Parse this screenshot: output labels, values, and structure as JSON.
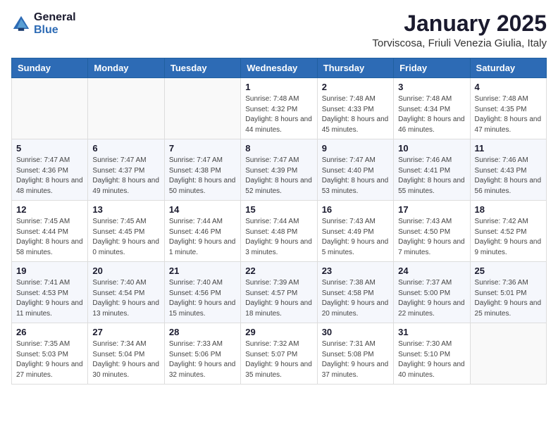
{
  "header": {
    "logo_general": "General",
    "logo_blue": "Blue",
    "month_title": "January 2025",
    "subtitle": "Torviscosa, Friuli Venezia Giulia, Italy"
  },
  "weekdays": [
    "Sunday",
    "Monday",
    "Tuesday",
    "Wednesday",
    "Thursday",
    "Friday",
    "Saturday"
  ],
  "weeks": [
    [
      {
        "day": "",
        "sunrise": "",
        "sunset": "",
        "daylight": ""
      },
      {
        "day": "",
        "sunrise": "",
        "sunset": "",
        "daylight": ""
      },
      {
        "day": "",
        "sunrise": "",
        "sunset": "",
        "daylight": ""
      },
      {
        "day": "1",
        "sunrise": "Sunrise: 7:48 AM",
        "sunset": "Sunset: 4:32 PM",
        "daylight": "Daylight: 8 hours and 44 minutes."
      },
      {
        "day": "2",
        "sunrise": "Sunrise: 7:48 AM",
        "sunset": "Sunset: 4:33 PM",
        "daylight": "Daylight: 8 hours and 45 minutes."
      },
      {
        "day": "3",
        "sunrise": "Sunrise: 7:48 AM",
        "sunset": "Sunset: 4:34 PM",
        "daylight": "Daylight: 8 hours and 46 minutes."
      },
      {
        "day": "4",
        "sunrise": "Sunrise: 7:48 AM",
        "sunset": "Sunset: 4:35 PM",
        "daylight": "Daylight: 8 hours and 47 minutes."
      }
    ],
    [
      {
        "day": "5",
        "sunrise": "Sunrise: 7:47 AM",
        "sunset": "Sunset: 4:36 PM",
        "daylight": "Daylight: 8 hours and 48 minutes."
      },
      {
        "day": "6",
        "sunrise": "Sunrise: 7:47 AM",
        "sunset": "Sunset: 4:37 PM",
        "daylight": "Daylight: 8 hours and 49 minutes."
      },
      {
        "day": "7",
        "sunrise": "Sunrise: 7:47 AM",
        "sunset": "Sunset: 4:38 PM",
        "daylight": "Daylight: 8 hours and 50 minutes."
      },
      {
        "day": "8",
        "sunrise": "Sunrise: 7:47 AM",
        "sunset": "Sunset: 4:39 PM",
        "daylight": "Daylight: 8 hours and 52 minutes."
      },
      {
        "day": "9",
        "sunrise": "Sunrise: 7:47 AM",
        "sunset": "Sunset: 4:40 PM",
        "daylight": "Daylight: 8 hours and 53 minutes."
      },
      {
        "day": "10",
        "sunrise": "Sunrise: 7:46 AM",
        "sunset": "Sunset: 4:41 PM",
        "daylight": "Daylight: 8 hours and 55 minutes."
      },
      {
        "day": "11",
        "sunrise": "Sunrise: 7:46 AM",
        "sunset": "Sunset: 4:43 PM",
        "daylight": "Daylight: 8 hours and 56 minutes."
      }
    ],
    [
      {
        "day": "12",
        "sunrise": "Sunrise: 7:45 AM",
        "sunset": "Sunset: 4:44 PM",
        "daylight": "Daylight: 8 hours and 58 minutes."
      },
      {
        "day": "13",
        "sunrise": "Sunrise: 7:45 AM",
        "sunset": "Sunset: 4:45 PM",
        "daylight": "Daylight: 9 hours and 0 minutes."
      },
      {
        "day": "14",
        "sunrise": "Sunrise: 7:44 AM",
        "sunset": "Sunset: 4:46 PM",
        "daylight": "Daylight: 9 hours and 1 minute."
      },
      {
        "day": "15",
        "sunrise": "Sunrise: 7:44 AM",
        "sunset": "Sunset: 4:48 PM",
        "daylight": "Daylight: 9 hours and 3 minutes."
      },
      {
        "day": "16",
        "sunrise": "Sunrise: 7:43 AM",
        "sunset": "Sunset: 4:49 PM",
        "daylight": "Daylight: 9 hours and 5 minutes."
      },
      {
        "day": "17",
        "sunrise": "Sunrise: 7:43 AM",
        "sunset": "Sunset: 4:50 PM",
        "daylight": "Daylight: 9 hours and 7 minutes."
      },
      {
        "day": "18",
        "sunrise": "Sunrise: 7:42 AM",
        "sunset": "Sunset: 4:52 PM",
        "daylight": "Daylight: 9 hours and 9 minutes."
      }
    ],
    [
      {
        "day": "19",
        "sunrise": "Sunrise: 7:41 AM",
        "sunset": "Sunset: 4:53 PM",
        "daylight": "Daylight: 9 hours and 11 minutes."
      },
      {
        "day": "20",
        "sunrise": "Sunrise: 7:40 AM",
        "sunset": "Sunset: 4:54 PM",
        "daylight": "Daylight: 9 hours and 13 minutes."
      },
      {
        "day": "21",
        "sunrise": "Sunrise: 7:40 AM",
        "sunset": "Sunset: 4:56 PM",
        "daylight": "Daylight: 9 hours and 15 minutes."
      },
      {
        "day": "22",
        "sunrise": "Sunrise: 7:39 AM",
        "sunset": "Sunset: 4:57 PM",
        "daylight": "Daylight: 9 hours and 18 minutes."
      },
      {
        "day": "23",
        "sunrise": "Sunrise: 7:38 AM",
        "sunset": "Sunset: 4:58 PM",
        "daylight": "Daylight: 9 hours and 20 minutes."
      },
      {
        "day": "24",
        "sunrise": "Sunrise: 7:37 AM",
        "sunset": "Sunset: 5:00 PM",
        "daylight": "Daylight: 9 hours and 22 minutes."
      },
      {
        "day": "25",
        "sunrise": "Sunrise: 7:36 AM",
        "sunset": "Sunset: 5:01 PM",
        "daylight": "Daylight: 9 hours and 25 minutes."
      }
    ],
    [
      {
        "day": "26",
        "sunrise": "Sunrise: 7:35 AM",
        "sunset": "Sunset: 5:03 PM",
        "daylight": "Daylight: 9 hours and 27 minutes."
      },
      {
        "day": "27",
        "sunrise": "Sunrise: 7:34 AM",
        "sunset": "Sunset: 5:04 PM",
        "daylight": "Daylight: 9 hours and 30 minutes."
      },
      {
        "day": "28",
        "sunrise": "Sunrise: 7:33 AM",
        "sunset": "Sunset: 5:06 PM",
        "daylight": "Daylight: 9 hours and 32 minutes."
      },
      {
        "day": "29",
        "sunrise": "Sunrise: 7:32 AM",
        "sunset": "Sunset: 5:07 PM",
        "daylight": "Daylight: 9 hours and 35 minutes."
      },
      {
        "day": "30",
        "sunrise": "Sunrise: 7:31 AM",
        "sunset": "Sunset: 5:08 PM",
        "daylight": "Daylight: 9 hours and 37 minutes."
      },
      {
        "day": "31",
        "sunrise": "Sunrise: 7:30 AM",
        "sunset": "Sunset: 5:10 PM",
        "daylight": "Daylight: 9 hours and 40 minutes."
      },
      {
        "day": "",
        "sunrise": "",
        "sunset": "",
        "daylight": ""
      }
    ]
  ]
}
